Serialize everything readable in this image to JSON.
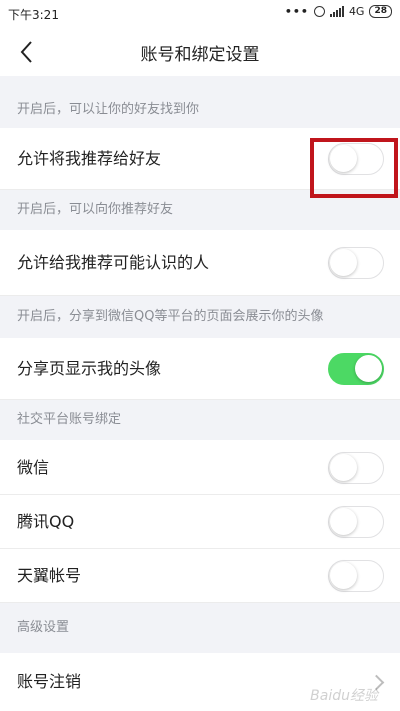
{
  "status_bar": {
    "time": "下午3:21",
    "dots": "•••",
    "network": "4G",
    "battery": "28"
  },
  "header": {
    "title": "账号和绑定设置"
  },
  "sections": [
    {
      "header": "开启后，可以让你的好友找到你",
      "rows": [
        {
          "label": "允许将我推荐给好友",
          "toggle_on": false
        }
      ]
    },
    {
      "header": "开启后，可以向你推荐好友",
      "rows": [
        {
          "label": "允许给我推荐可能认识的人",
          "toggle_on": false
        }
      ]
    },
    {
      "header": "开启后，分享到微信QQ等平台的页面会展示你的头像",
      "rows": [
        {
          "label": "分享页显示我的头像",
          "toggle_on": true
        }
      ]
    },
    {
      "header": "社交平台账号绑定",
      "rows": [
        {
          "label": "微信",
          "toggle_on": false
        },
        {
          "label": "腾讯QQ",
          "toggle_on": false
        },
        {
          "label": "天翼帐号",
          "toggle_on": false
        }
      ]
    },
    {
      "header": "高级设置",
      "rows": [
        {
          "label": "账号注销"
        }
      ]
    }
  ],
  "colors": {
    "toggle_on": "#4cd964",
    "highlight": "#c0151c",
    "background": "#f2f3f7"
  },
  "watermark": "Baidu经验"
}
